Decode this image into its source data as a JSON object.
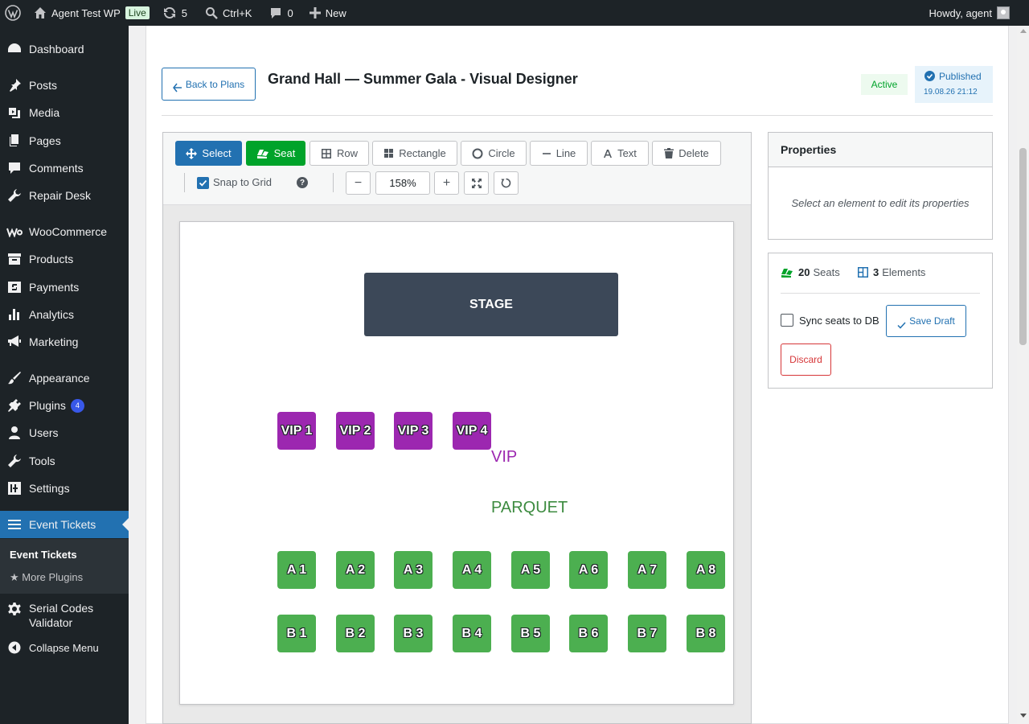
{
  "admin_bar": {
    "site_name": "Agent Test WP",
    "live_badge": "Live",
    "updates_count": "5",
    "search_shortcut": "Ctrl+K",
    "comments_count": "0",
    "new_label": "New",
    "howdy": "Howdy, agent"
  },
  "sidebar": {
    "items": {
      "dashboard": "Dashboard",
      "posts": "Posts",
      "media": "Media",
      "pages": "Pages",
      "comments": "Comments",
      "repair_desk": "Repair Desk",
      "woocommerce": "WooCommerce",
      "products": "Products",
      "payments": "Payments",
      "analytics": "Analytics",
      "marketing": "Marketing",
      "appearance": "Appearance",
      "plugins": "Plugins",
      "plugins_badge": "4",
      "users": "Users",
      "tools": "Tools",
      "settings": "Settings",
      "event_tickets": "Event Tickets",
      "serial_codes_1": "Serial Codes",
      "serial_codes_2": "Validator",
      "collapse": "Collapse Menu"
    },
    "submenu": {
      "event_tickets": "Event Tickets",
      "more_plugins": "★ More Plugins"
    }
  },
  "header": {
    "back_label": "Back to Plans",
    "title": "Grand Hall — Summer Gala - Visual Designer",
    "status": "Active",
    "published_label": "Published",
    "published_date": "19.08.26 21:12"
  },
  "toolbar": {
    "select": "Select",
    "seat": "Seat",
    "row": "Row",
    "rectangle": "Rectangle",
    "circle": "Circle",
    "line": "Line",
    "text": "Text",
    "delete": "Delete",
    "snap_label": "Snap to Grid",
    "help": "?",
    "zoom_out": "−",
    "zoom_value": "158%",
    "zoom_in": "+"
  },
  "canvas": {
    "stage_label": "STAGE",
    "vip_label": "VIP",
    "parquet_label": "PARQUET",
    "vip_seats": [
      "VIP 1",
      "VIP 2",
      "VIP 3",
      "VIP 4"
    ],
    "row_a": [
      "A 1",
      "A 2",
      "A 3",
      "A 4",
      "A 5",
      "A 6",
      "A 7",
      "A 8"
    ],
    "row_b": [
      "B 1",
      "B 2",
      "B 3",
      "B 4",
      "B 5",
      "B 6",
      "B 7",
      "B 8"
    ]
  },
  "properties": {
    "title": "Properties",
    "empty_text": "Select an element to edit its properties"
  },
  "summary": {
    "seats_count": "20",
    "seats_label": "Seats",
    "elements_count": "3",
    "elements_label": "Elements",
    "sync_label": "Sync seats to DB",
    "save_draft": "Save Draft",
    "discard": "Discard"
  },
  "colors": {
    "accent": "#2271b1",
    "success": "#00a32a",
    "vip": "#9c27b0",
    "parquet": "#4caf50",
    "parquet_label": "#3d8b40",
    "stage": "#3c4858",
    "danger": "#d63638"
  }
}
